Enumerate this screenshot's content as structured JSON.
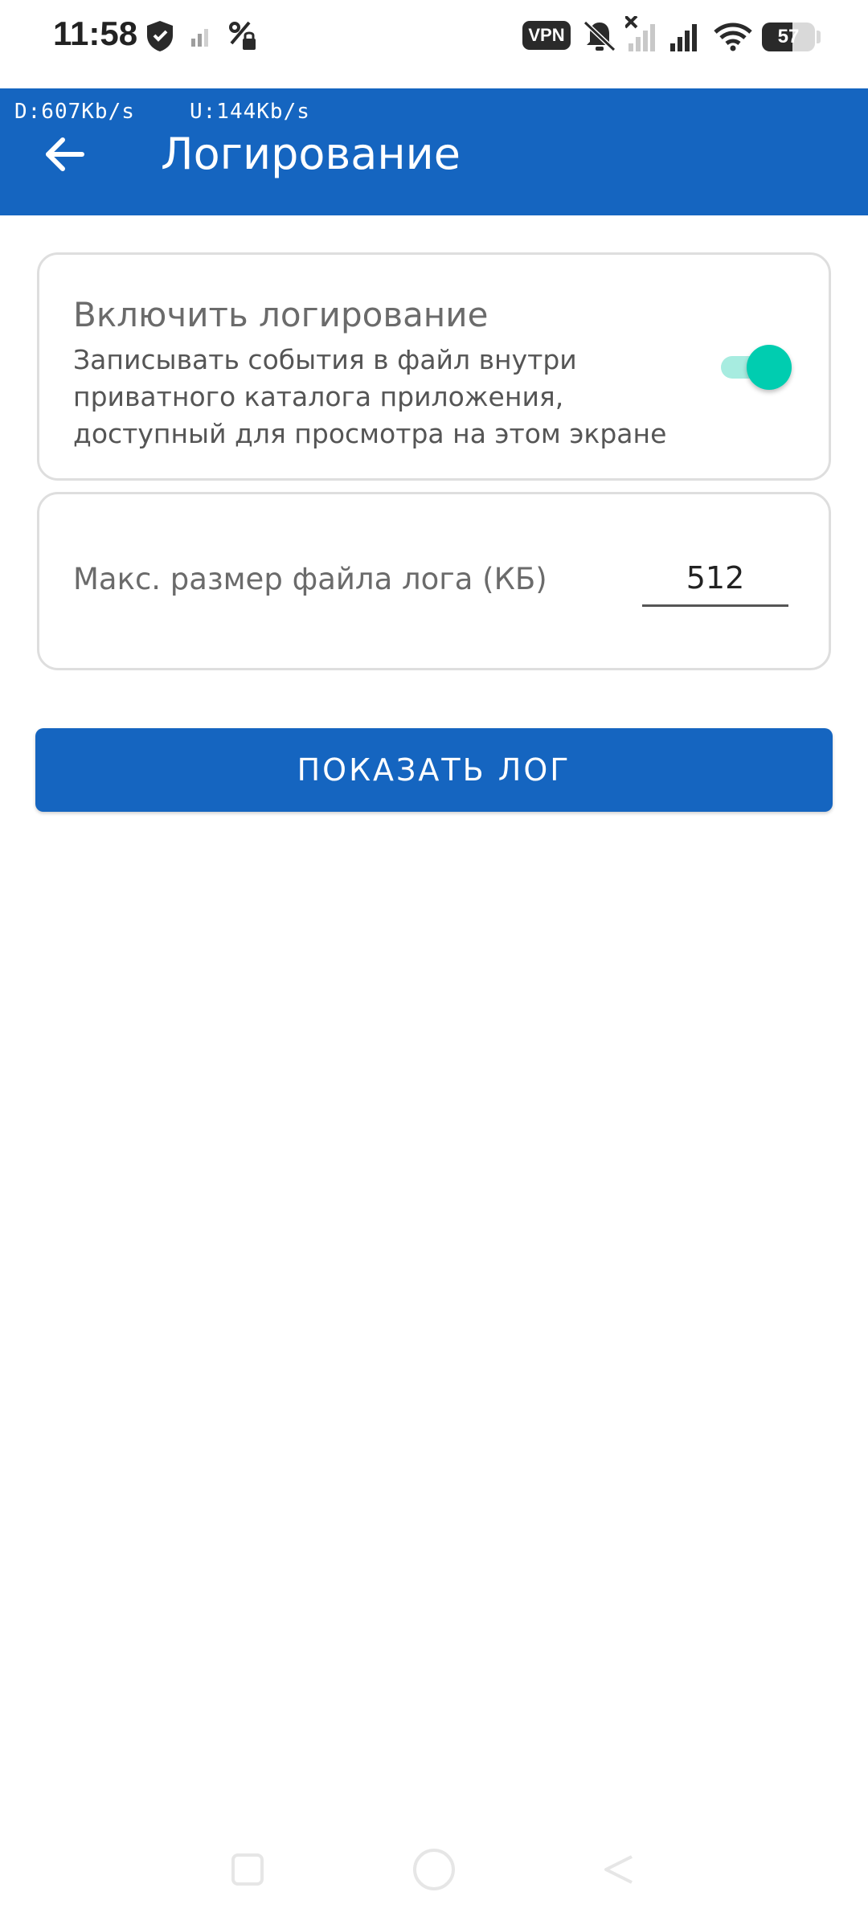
{
  "status_bar": {
    "time": "11:58",
    "vpn_label": "VPN",
    "battery_level": "57",
    "icons": [
      "shield-icon",
      "signal-weak-icon",
      "data-saver-icon",
      "vibrate-off-icon",
      "signal-no-service-icon",
      "signal-icon",
      "wifi-icon",
      "battery-icon"
    ]
  },
  "app_bar": {
    "speed_down": "D:607Kb/s",
    "speed_up": "U:144Kb/s",
    "title": "Логирование",
    "back_icon": "arrow-back-icon",
    "background_color": "#1565c0"
  },
  "logging_card": {
    "title": "Включить логирование",
    "description": "Записывать события в файл внутри приватного каталога приложения, доступный для просмотра на этом экране",
    "enabled": true,
    "toggle_color": "#00cdb0"
  },
  "size_card": {
    "label": "Макс. размер файла лога (КБ)",
    "value": "512"
  },
  "show_log_button": {
    "label": "ПОКАЗАТЬ ЛОГ",
    "color": "#1565c0"
  },
  "nav_bar": {
    "icons": [
      "recent-apps-icon",
      "home-icon",
      "back-icon"
    ]
  }
}
